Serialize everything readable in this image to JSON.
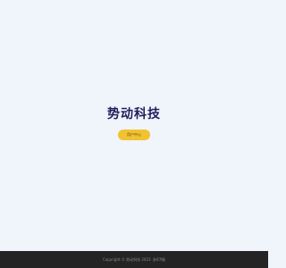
{
  "colors": {
    "page_background": "#f0f4fb",
    "brand_title": "#1f1f5c",
    "button_background": "#f2c230",
    "footer_background": "#242424",
    "footer_text": "#8a8a8a"
  },
  "hero": {
    "brand_name": "势动科技",
    "cta_label": "用户中心"
  },
  "footer": {
    "copyright": "Copyright © 势动科技 2023",
    "icp_link": "浙ICP备"
  }
}
